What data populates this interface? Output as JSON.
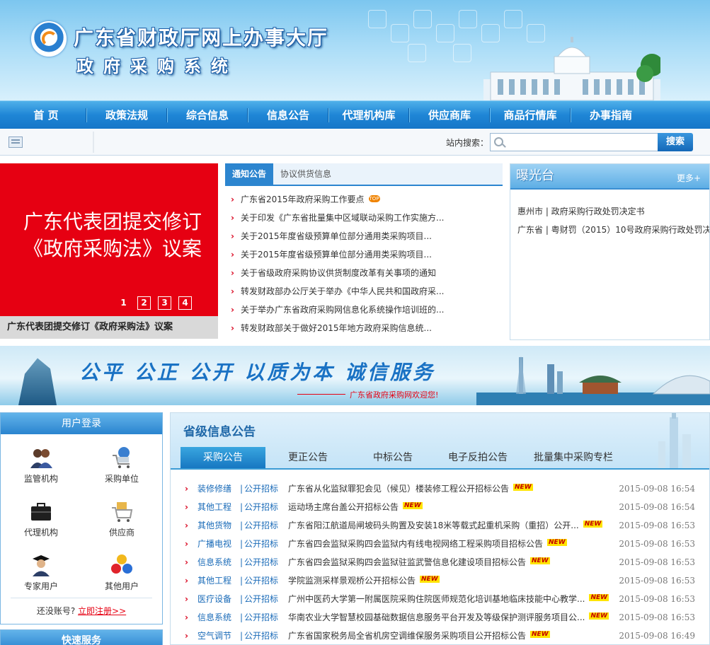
{
  "header": {
    "title": "广东省财政厅网上办事大厅",
    "subtitle": "政府采购系统"
  },
  "nav": {
    "items": [
      "首 页",
      "政策法规",
      "综合信息",
      "信息公告",
      "代理机构库",
      "供应商库",
      "商品行情库",
      "办事指南"
    ]
  },
  "search": {
    "label": "站内搜索：",
    "placeholder": "",
    "button": "搜索"
  },
  "slider": {
    "headline_line1": "广东代表团提交修订",
    "headline_line2": "《政府采购法》议案",
    "pages": [
      "1",
      "2",
      "3",
      "4"
    ],
    "active_page": "1",
    "caption": "广东代表团提交修订《政府采购法》议案"
  },
  "notices": {
    "tabs": [
      "通知公告",
      "协议供货信息"
    ],
    "active_tab": "通知公告",
    "top_badge": "TOP",
    "items": [
      "广东省2015年政府采购工作要点",
      "关于印发《广东省批量集中区域联动采购工作实施方...",
      "关于2015年度省级预算单位部分通用类采购项目...",
      "关于2015年度省级预算单位部分通用类采购项目...",
      "关于省级政府采购协议供货制度改革有关事项的通知",
      "转发财政部办公厅关于举办《中华人民共和国政府采...",
      "关于举办广东省政府采购网信息化系统操作培训班的...",
      "转发财政部关于做好2015年地方政府采购信息统..."
    ]
  },
  "exposure": {
    "title": "曝光台",
    "more": "更多+",
    "items": [
      "惠州市 | 政府采购行政处罚决定书",
      "广东省 | 粤财罚（2015）10号政府采购行政处罚决"
    ]
  },
  "banner": {
    "slogan": "公平 公正 公开 以质为本 诚信服务",
    "welcome": "广东省政府采购网欢迎您!"
  },
  "login": {
    "title": "用户登录",
    "roles": [
      {
        "label": "监管机构",
        "icon": "users-icon"
      },
      {
        "label": "采购单位",
        "icon": "shopping-cart-icon"
      },
      {
        "label": "代理机构",
        "icon": "briefcase-icon"
      },
      {
        "label": "供应商",
        "icon": "goods-cart-icon"
      },
      {
        "label": "专家用户",
        "icon": "graduate-icon"
      },
      {
        "label": "其他用户",
        "icon": "balls-icon"
      }
    ],
    "register_prompt": "还没账号?",
    "register_link": "立即注册>>"
  },
  "quick_service": {
    "title": "快速服务"
  },
  "provincial": {
    "title": "省级信息公告",
    "tabs": [
      "采购公告",
      "更正公告",
      "中标公告",
      "电子反拍公告",
      "批量集中采购专栏"
    ],
    "active_tab": "采购公告",
    "new_badge": "NEW",
    "separator": "|",
    "items": [
      {
        "category": "装修修缮",
        "type": "公开招标",
        "title": "广东省从化监狱罪犯会见（候见）楼装修工程公开招标公告",
        "date": "2015-09-08 16:54"
      },
      {
        "category": "其他工程",
        "type": "公开招标",
        "title": "运动场主席台盖公开招标公告",
        "date": "2015-09-08 16:54"
      },
      {
        "category": "其他货物",
        "type": "公开招标",
        "title": "广东省阳江航道局闸坡码头购置及安装18米等载式起重机采购（重招）公开...",
        "date": "2015-09-08 16:53"
      },
      {
        "category": "广播电视",
        "type": "公开招标",
        "title": "广东省四会监狱采购四会监狱内有线电视网络工程采购项目招标公告",
        "date": "2015-09-08 16:53"
      },
      {
        "category": "信息系统",
        "type": "公开招标",
        "title": "广东省四会监狱采购四会监狱驻监武警信息化建设项目招标公告",
        "date": "2015-09-08 16:53"
      },
      {
        "category": "其他工程",
        "type": "公开招标",
        "title": "学院监测采样景观桥公开招标公告",
        "date": "2015-09-08 16:53"
      },
      {
        "category": "医疗设备",
        "type": "公开招标",
        "title": "广州中医药大学第一附属医院采购住院医师规范化培训基地临床技能中心教学...",
        "date": "2015-09-08 16:53"
      },
      {
        "category": "信息系统",
        "type": "公开招标",
        "title": "华南农业大学智慧校园基础数据信息服务平台开发及等级保护测评服务项目公...",
        "date": "2015-09-08 16:53"
      },
      {
        "category": "空气调节",
        "type": "公开招标",
        "title": "广东省国家税务局全省机房空调维保服务采购项目公开招标公告",
        "date": "2015-09-08 16:49"
      }
    ]
  },
  "colors": {
    "nav_blue": "#1f86d6",
    "slide_red": "#e60012",
    "link_blue": "#1a6bb8",
    "accent_red": "#d9001b"
  }
}
